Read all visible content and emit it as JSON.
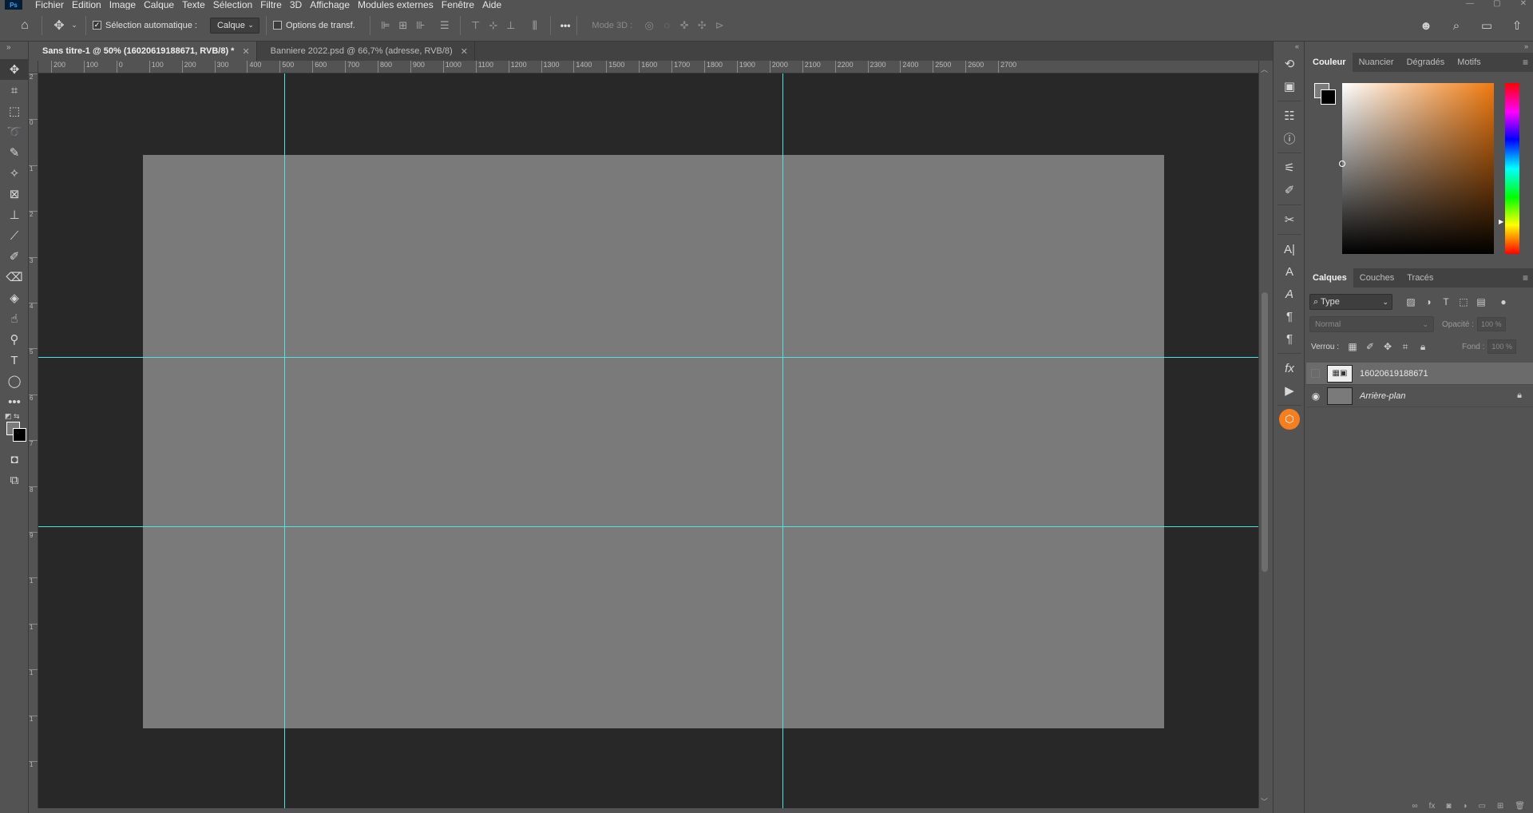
{
  "menu": {
    "logo": "Ps",
    "items": [
      "Fichier",
      "Edition",
      "Image",
      "Calque",
      "Texte",
      "Sélection",
      "Filtre",
      "3D",
      "Affichage",
      "Modules externes",
      "Fenêtre",
      "Aide"
    ]
  },
  "options_bar": {
    "auto_select_label": "Sélection automatique :",
    "auto_select_checked": true,
    "target_value": "Calque",
    "transform_label": "Options de transf.",
    "more_label": "•••",
    "mode3d_label": "Mode 3D :"
  },
  "doc_tabs": [
    {
      "label": "Sans titre-1 @ 50% (16020619188671, RVB/8) *",
      "active": true
    },
    {
      "label": "Banniere 2022.psd @ 66,7% (adresse, RVB/8)",
      "active": false
    }
  ],
  "ruler_h_labels": [
    "200",
    "100",
    "0",
    "100",
    "200",
    "300",
    "400",
    "500",
    "600",
    "700",
    "800",
    "900",
    "1000",
    "1100",
    "1200",
    "1300",
    "1400",
    "1500",
    "1600",
    "1700",
    "1800",
    "1900",
    "2000",
    "2100",
    "2200",
    "2300",
    "2400",
    "2500",
    "2600",
    "2700"
  ],
  "ruler_v_labels": [
    "2",
    "0",
    "1",
    "2",
    "3",
    "4",
    "5",
    "6",
    "7",
    "8",
    "9",
    "1",
    "1",
    "1",
    "1",
    "1"
  ],
  "color_panel": {
    "tabs": [
      "Couleur",
      "Nuancier",
      "Dégradés",
      "Motifs"
    ],
    "fg_color": "#7b7b7b",
    "bg_color": "#000000",
    "hue_color": "#f07a10"
  },
  "layers_panel": {
    "tabs": [
      "Calques",
      "Couches",
      "Tracés"
    ],
    "filter_value": "Type",
    "blend_mode": "Normal",
    "opacity_label": "Opacité :",
    "opacity_value": "100 %",
    "lock_label": "Verrou :",
    "fill_label": "Fond :",
    "fill_value": "100 %",
    "layers": [
      {
        "name": "16020619188671",
        "visible": false,
        "selected": true,
        "smart_object": true,
        "locked": false,
        "italic": false
      },
      {
        "name": "Arrière-plan",
        "visible": true,
        "selected": false,
        "smart_object": false,
        "locked": true,
        "italic": true
      }
    ]
  },
  "colors": {
    "guide": "#4fe3e6",
    "canvas_bg": "#282828",
    "document": "#7a7a7a",
    "ui": "#535353"
  }
}
